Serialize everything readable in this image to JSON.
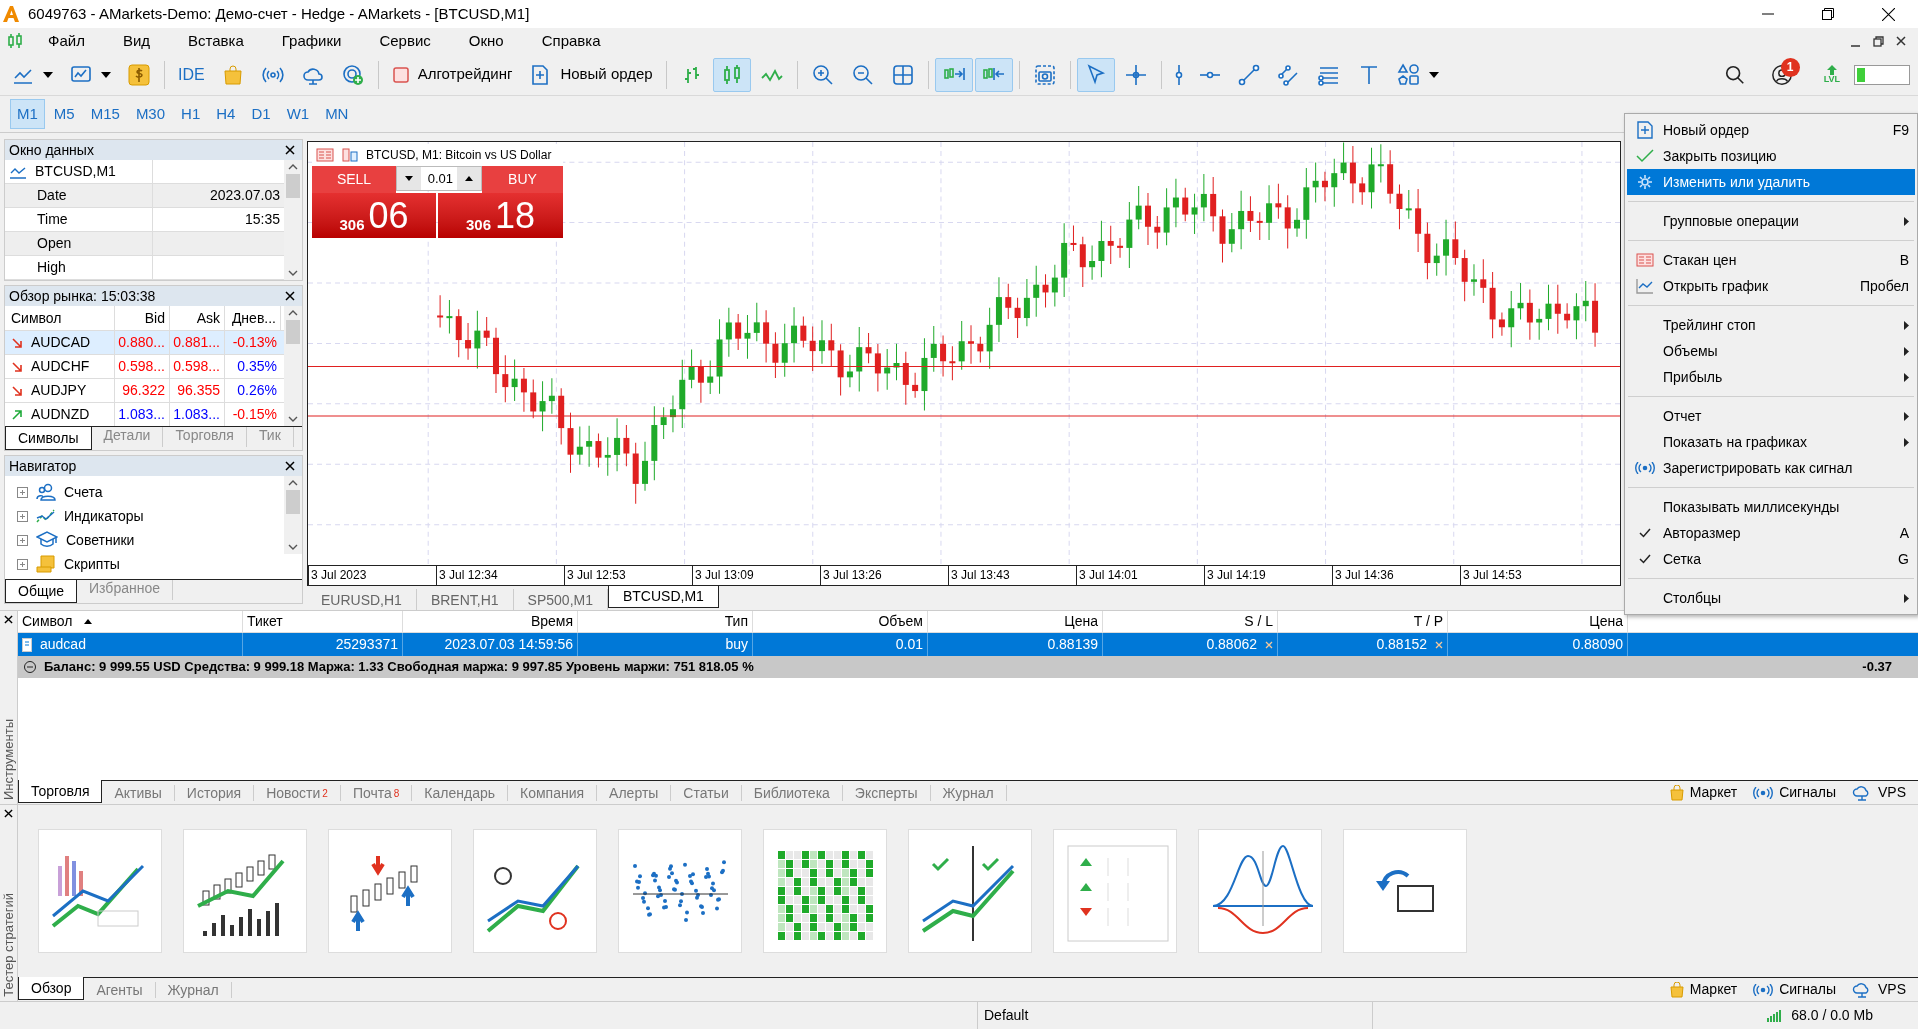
{
  "window": {
    "title": "6049763 - AMarkets-Demo: Демо-счет - Hedge - AMarkets - [BTCUSD,M1]"
  },
  "menu": [
    "Файл",
    "Вид",
    "Вставка",
    "Графики",
    "Сервис",
    "Окно",
    "Справка"
  ],
  "toolbar": [
    {
      "kind": "line-chart",
      "selected": false
    },
    {
      "kind": "template",
      "selected": false
    },
    {
      "kind": "dollar",
      "selected": false
    },
    {
      "kind": "separator"
    },
    {
      "kind": "text",
      "label": "IDE",
      "selected": false
    },
    {
      "kind": "bag",
      "selected": false
    },
    {
      "kind": "signal",
      "selected": false
    },
    {
      "kind": "cloud",
      "selected": false
    },
    {
      "kind": "target-add",
      "selected": false
    },
    {
      "kind": "separator"
    },
    {
      "kind": "algo",
      "label": "Алготрейдинг",
      "selected": false
    },
    {
      "kind": "new-order",
      "label": "Новый ордер",
      "selected": false
    },
    {
      "kind": "separator"
    },
    {
      "kind": "bars",
      "selected": false
    },
    {
      "kind": "candles",
      "selected": true
    },
    {
      "kind": "line",
      "selected": false
    },
    {
      "kind": "separator"
    },
    {
      "kind": "zoom-in",
      "selected": false
    },
    {
      "kind": "zoom-out",
      "selected": false
    },
    {
      "kind": "tile",
      "selected": false
    },
    {
      "kind": "separator"
    },
    {
      "kind": "autoscroll",
      "selected": true
    },
    {
      "kind": "shift",
      "selected": true
    },
    {
      "kind": "separator"
    },
    {
      "kind": "screenshot",
      "selected": false
    },
    {
      "kind": "separator"
    },
    {
      "kind": "cursor",
      "selected": true
    },
    {
      "kind": "crosshair",
      "selected": false
    },
    {
      "kind": "separator"
    },
    {
      "kind": "vline",
      "selected": false
    },
    {
      "kind": "hline",
      "selected": false
    },
    {
      "kind": "trendline",
      "selected": false
    },
    {
      "kind": "channel",
      "selected": false
    },
    {
      "kind": "fibo",
      "selected": false
    },
    {
      "kind": "text-tool",
      "selected": false
    },
    {
      "kind": "shapes",
      "selected": false
    }
  ],
  "notifications": "1",
  "lvl_label": "LVL",
  "timeframes": [
    {
      "label": "M1",
      "selected": true
    },
    {
      "label": "M5",
      "selected": false
    },
    {
      "label": "M15",
      "selected": false
    },
    {
      "label": "M30",
      "selected": false
    },
    {
      "label": "H1",
      "selected": false
    },
    {
      "label": "H4",
      "selected": false
    },
    {
      "label": "D1",
      "selected": false
    },
    {
      "label": "W1",
      "selected": false
    },
    {
      "label": "MN",
      "selected": false
    }
  ],
  "data_window": {
    "title": "Окно данных",
    "symbol": "BTCUSD,M1",
    "rows": [
      {
        "name": "Date",
        "value": "2023.07.03"
      },
      {
        "name": "Time",
        "value": "15:35"
      },
      {
        "name": "Open"
      },
      {
        "name": "High"
      }
    ]
  },
  "market_watch": {
    "title": "Обзор рынка: 15:03:38",
    "columns": [
      "Символ",
      "Bid",
      "Ask",
      "Днев..."
    ],
    "rows": [
      {
        "symbol": "AUDCAD",
        "kind": "falling",
        "bid": "0.880...",
        "ask": "0.881...",
        "change": "-0.13%",
        "color": "#ff0000",
        "selected": true
      },
      {
        "symbol": "AUDCHF",
        "kind": "falling",
        "bid": "0.598...",
        "ask": "0.598...",
        "change": "0.35%",
        "color": "#0000ff",
        "selected": false
      },
      {
        "symbol": "AUDJPY",
        "kind": "falling",
        "bid": "96.322",
        "ask": "96.355",
        "change": "0.26%",
        "color": "#0000ff",
        "selected": false
      },
      {
        "symbol": "AUDNZD",
        "kind": "rising",
        "bid": "1.083...",
        "ask": "1.083...",
        "change": "-0.15%",
        "color": "#ff0000",
        "selected": false
      }
    ],
    "tabs": [
      {
        "label": "Символы",
        "selected": true
      },
      {
        "label": "Детали",
        "selected": false
      },
      {
        "label": "Торговля",
        "selected": false
      },
      {
        "label": "Тик",
        "selected": false
      }
    ]
  },
  "navigator": {
    "title": "Навигатор",
    "items": [
      {
        "label": "Счета",
        "kind": "accounts"
      },
      {
        "label": "Индикаторы",
        "kind": "indicators"
      },
      {
        "label": "Советники",
        "kind": "experts"
      },
      {
        "label": "Скрипты",
        "kind": "scripts"
      }
    ],
    "tabs": [
      {
        "label": "Общие",
        "selected": true
      },
      {
        "label": "Избранное",
        "selected": false
      }
    ]
  },
  "chart": {
    "title": "BTCUSD, M1: Bitcoin vs US Dollar",
    "sell": "SELL",
    "buy": "BUY",
    "volume": "0.01",
    "sell_small": "306",
    "sell_big": "06",
    "buy_small": "306",
    "buy_big": "18",
    "time_labels": [
      "3 Jul 2023",
      "3 Jul 12:34",
      "3 Jul 12:53",
      "3 Jul 13:09",
      "3 Jul 13:26",
      "3 Jul 13:43",
      "3 Jul 14:01",
      "3 Jul 14:19",
      "3 Jul 14:36",
      "3 Jul 14:53"
    ],
    "tabs": [
      {
        "label": "EURUSD,H1",
        "selected": false
      },
      {
        "label": "BRENT,H1",
        "selected": false
      },
      {
        "label": "SP500,M1",
        "selected": false
      },
      {
        "label": "BTCUSD,M1",
        "selected": true
      }
    ]
  },
  "context_menu": [
    {
      "kind": "order",
      "label": "Новый ордер",
      "shortcut": "F9",
      "selected": false
    },
    {
      "kind": "close",
      "label": "Закрыть позицию",
      "selected": false
    },
    {
      "kind": "edit",
      "label": "Изменить или удалить",
      "selected": true
    },
    {
      "kind": "separator"
    },
    {
      "kind": "plain",
      "label": "Групповые операции",
      "submenu": true,
      "selected": false
    },
    {
      "kind": "separator"
    },
    {
      "kind": "depth",
      "label": "Стакан цен",
      "shortcut": "B",
      "selected": false
    },
    {
      "kind": "chart",
      "label": "Открыть график",
      "shortcut": "Пробел",
      "selected": false
    },
    {
      "kind": "separator"
    },
    {
      "kind": "plain",
      "label": "Трейлинг стоп",
      "submenu": true,
      "selected": false
    },
    {
      "kind": "plain",
      "label": "Объемы",
      "submenu": true,
      "selected": false
    },
    {
      "kind": "plain",
      "label": "Прибыль",
      "submenu": true,
      "selected": false
    },
    {
      "kind": "separator"
    },
    {
      "kind": "plain",
      "label": "Отчет",
      "submenu": true,
      "selected": false
    },
    {
      "kind": "plain",
      "label": "Показать на графиках",
      "submenu": true,
      "selected": false
    },
    {
      "kind": "signal",
      "label": "Зарегистрировать как сигнал",
      "selected": false
    },
    {
      "kind": "separator"
    },
    {
      "kind": "plain",
      "label": "Показывать миллисекунды",
      "checked": false,
      "selected": false
    },
    {
      "kind": "plain",
      "label": "Авторазмер",
      "shortcut": "A",
      "checked": true,
      "selected": false
    },
    {
      "kind": "plain",
      "label": "Сетка",
      "shortcut": "G",
      "checked": true,
      "selected": false
    },
    {
      "kind": "separator"
    },
    {
      "kind": "plain",
      "label": "Столбцы",
      "submenu": true,
      "selected": false
    }
  ],
  "toolbox": {
    "side_label": "Инструменты",
    "columns": [
      {
        "label": "Символ",
        "sorted": true
      },
      {
        "label": "Тикет",
        "sorted": false
      },
      {
        "label": "Время",
        "sorted": false
      },
      {
        "label": "Тип",
        "sorted": false
      },
      {
        "label": "Объем",
        "sorted": false
      },
      {
        "label": "Цена",
        "sorted": false
      },
      {
        "label": "S / L",
        "sorted": false
      },
      {
        "label": "T / P",
        "sorted": false
      },
      {
        "label": "Цена",
        "sorted": false
      }
    ],
    "rows": [
      {
        "selected": true,
        "cells": [
          "audcad",
          "25293371",
          "2023.07.03 14:59:56",
          "buy",
          "0.01",
          "0.88139",
          "0.88062",
          "0.88152",
          "0.88090"
        ]
      }
    ],
    "summary": "Баланс: 9 999.55 USD Средства: 9 999.18 Маржа: 1.33 Свободная маржа: 9 997.85 Уровень маржи: 751 818.05 %",
    "summary_profit": "-0.37",
    "tabs": [
      {
        "label": "Торговля",
        "selected": true
      },
      {
        "label": "Активы",
        "selected": false
      },
      {
        "label": "История",
        "selected": false
      },
      {
        "label": "Новости",
        "badge": "2",
        "selected": false
      },
      {
        "label": "Почта",
        "badge": "8",
        "selected": false
      },
      {
        "label": "Календарь",
        "selected": false
      },
      {
        "label": "Компания",
        "selected": false
      },
      {
        "label": "Алерты",
        "selected": false
      },
      {
        "label": "Статьи",
        "selected": false
      },
      {
        "label": "Библиотека",
        "selected": false
      },
      {
        "label": "Эксперты",
        "selected": false
      },
      {
        "label": "Журнал",
        "selected": false
      }
    ],
    "links": [
      "Маркет",
      "Сигналы",
      "VPS"
    ]
  },
  "tester": {
    "side_label": "Тестер стратегий",
    "tiles": [
      {
        "kind": "bars-line"
      },
      {
        "kind": "candles-volume"
      },
      {
        "kind": "candles-arrows"
      },
      {
        "kind": "timers"
      },
      {
        "kind": "scatter"
      },
      {
        "kind": "heatmap"
      },
      {
        "kind": "split"
      },
      {
        "kind": "currencies"
      },
      {
        "kind": "distribution"
      },
      {
        "kind": "open-folder"
      }
    ],
    "tabs": [
      {
        "label": "Обзор",
        "selected": true
      },
      {
        "label": "Агенты",
        "selected": false
      },
      {
        "label": "Журнал",
        "selected": false
      }
    ],
    "links": [
      "Маркет",
      "Сигналы",
      "VPS"
    ]
  },
  "status_bar": {
    "profile": "Default",
    "traffic": "68.0 / 0.0 Mb"
  }
}
